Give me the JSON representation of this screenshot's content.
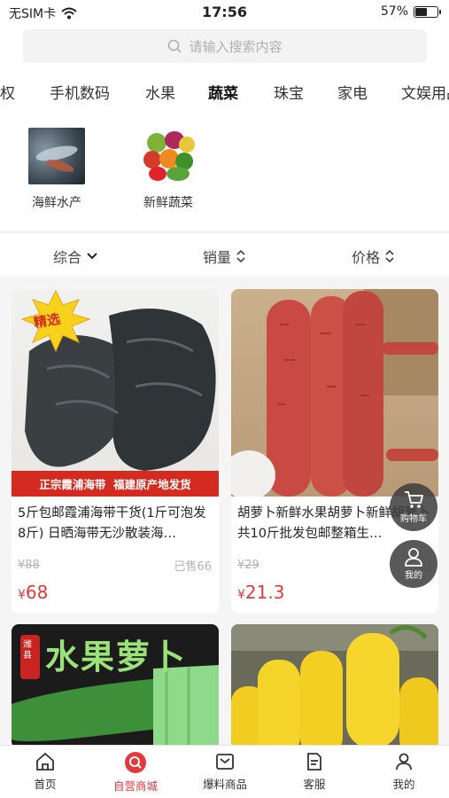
{
  "status_bar": {
    "carrier": "无SIM卡",
    "time": "17:56",
    "battery": "57%",
    "battery_level": 0.57
  },
  "search": {
    "placeholder": "请输入搜索内容"
  },
  "category_tabs": [
    "权",
    "手机数码",
    "水果",
    "蔬菜",
    "珠宝",
    "家电",
    "文娱用品"
  ],
  "active_category": "蔬菜",
  "sub_categories": [
    {
      "label": "海鲜水产",
      "icon": "seafood-thumbnail"
    },
    {
      "label": "新鲜蔬菜",
      "icon": "vegetables-thumbnail"
    }
  ],
  "sort": {
    "overall": "综合",
    "sales": "销量",
    "price": "价格"
  },
  "products": [
    {
      "title": "5斤包邮霞浦海带干货(1斤可泡发8斤) 日晒海带无沙散装海…",
      "original_price": "¥88",
      "sold": "已售66",
      "price_symbol": "¥",
      "price_value": "68",
      "badge": "精选",
      "banner": "正宗霞浦海带  福建原产地发货"
    },
    {
      "title": "胡萝卜新鲜水果胡萝卜新鲜胡萝卜共10斤批发包邮整箱生…",
      "original_price": "¥29",
      "sold": "已",
      "price_symbol": "¥",
      "price_value": "21.3"
    },
    {
      "banner_small": "潍县",
      "banner": "水果萝卜"
    },
    {}
  ],
  "float_buttons": {
    "cart": "购物车",
    "mine": "我的"
  },
  "tabbar": [
    "首页",
    "自营商城",
    "爆料商品",
    "客服",
    "我的"
  ],
  "colors": {
    "accent": "#e4393c",
    "text": "#222222",
    "muted": "#b3b3b3"
  }
}
